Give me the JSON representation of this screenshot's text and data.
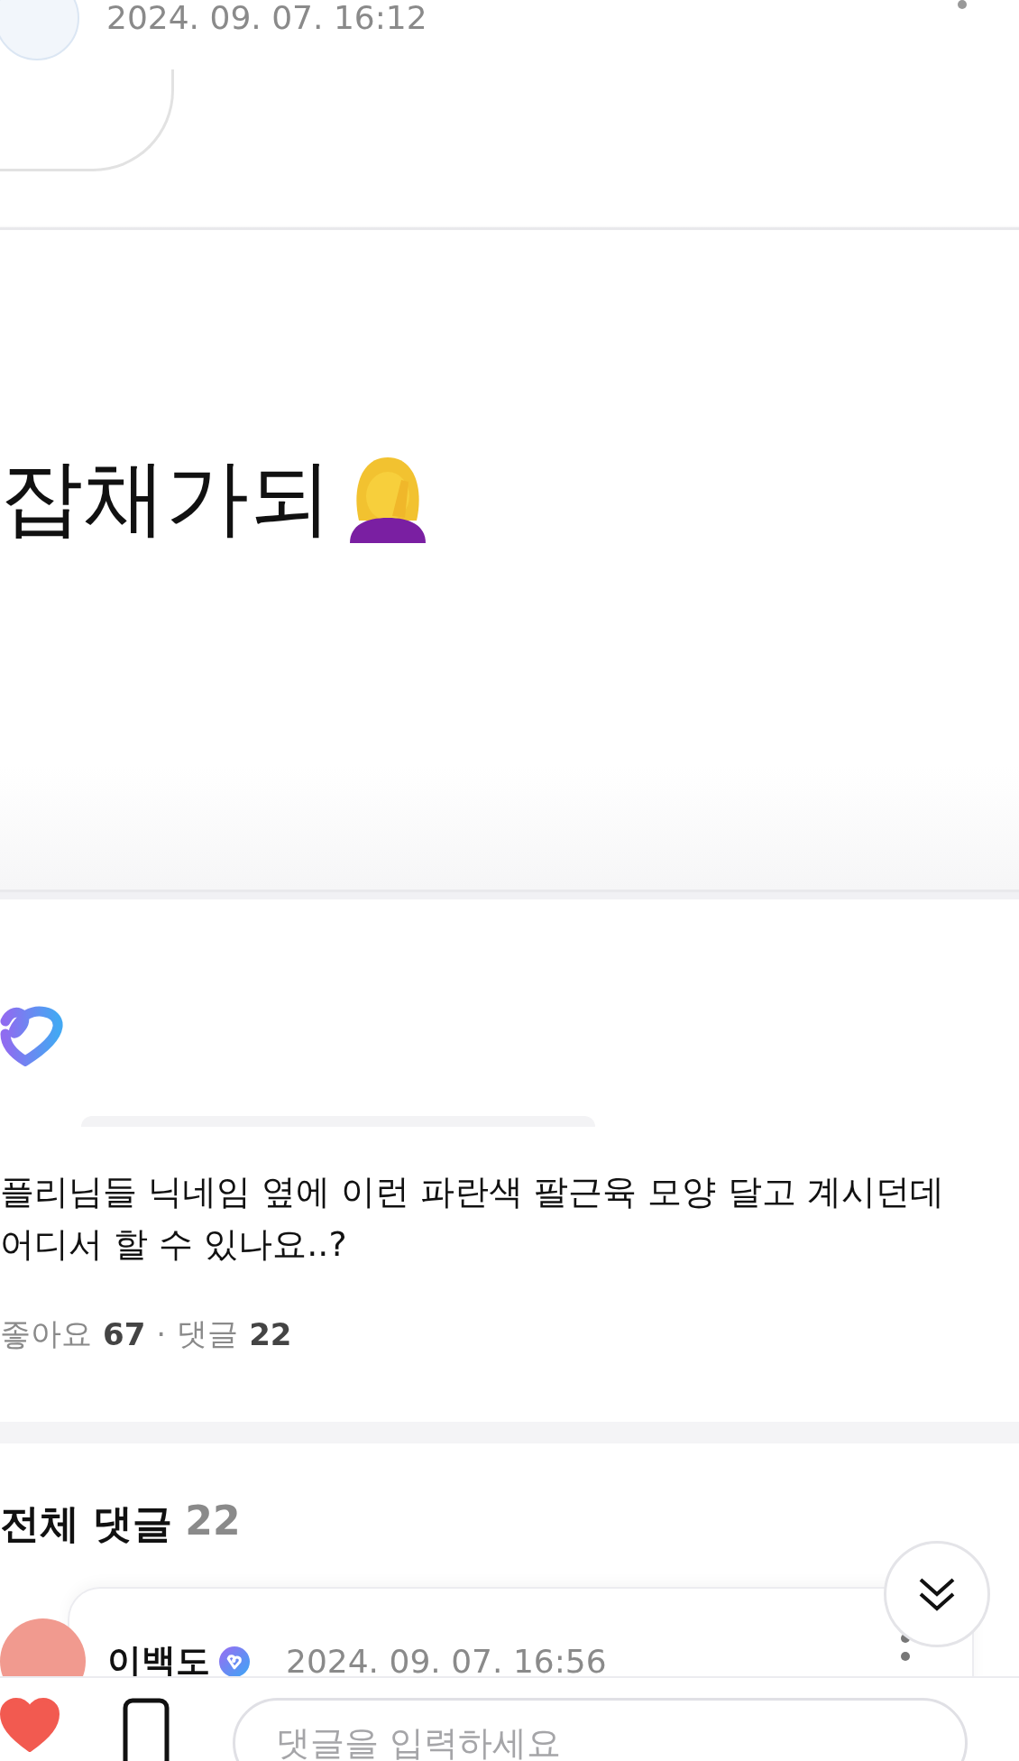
{
  "embedded_screenshot": {
    "post_date": "2024. 09. 07. 16:12",
    "caption": "잡채가되"
  },
  "post": {
    "text": "플리님들 닉네임 옆에 이런 파란색 팔근육 모양 달고 계시던데\n어디서 할 수 있나요..?",
    "like_label": "좋아요",
    "like_count": "67",
    "separator": "·",
    "comment_label": "댓글",
    "comment_count": "22"
  },
  "comments": {
    "title": "전체 댓글",
    "count": "22",
    "items": [
      {
        "author": "이백도",
        "verified": true,
        "date": "2024. 09. 07. 16:56"
      }
    ]
  },
  "bottom_bar": {
    "liked": true,
    "placeholder": "댓글을 입력하세요"
  }
}
